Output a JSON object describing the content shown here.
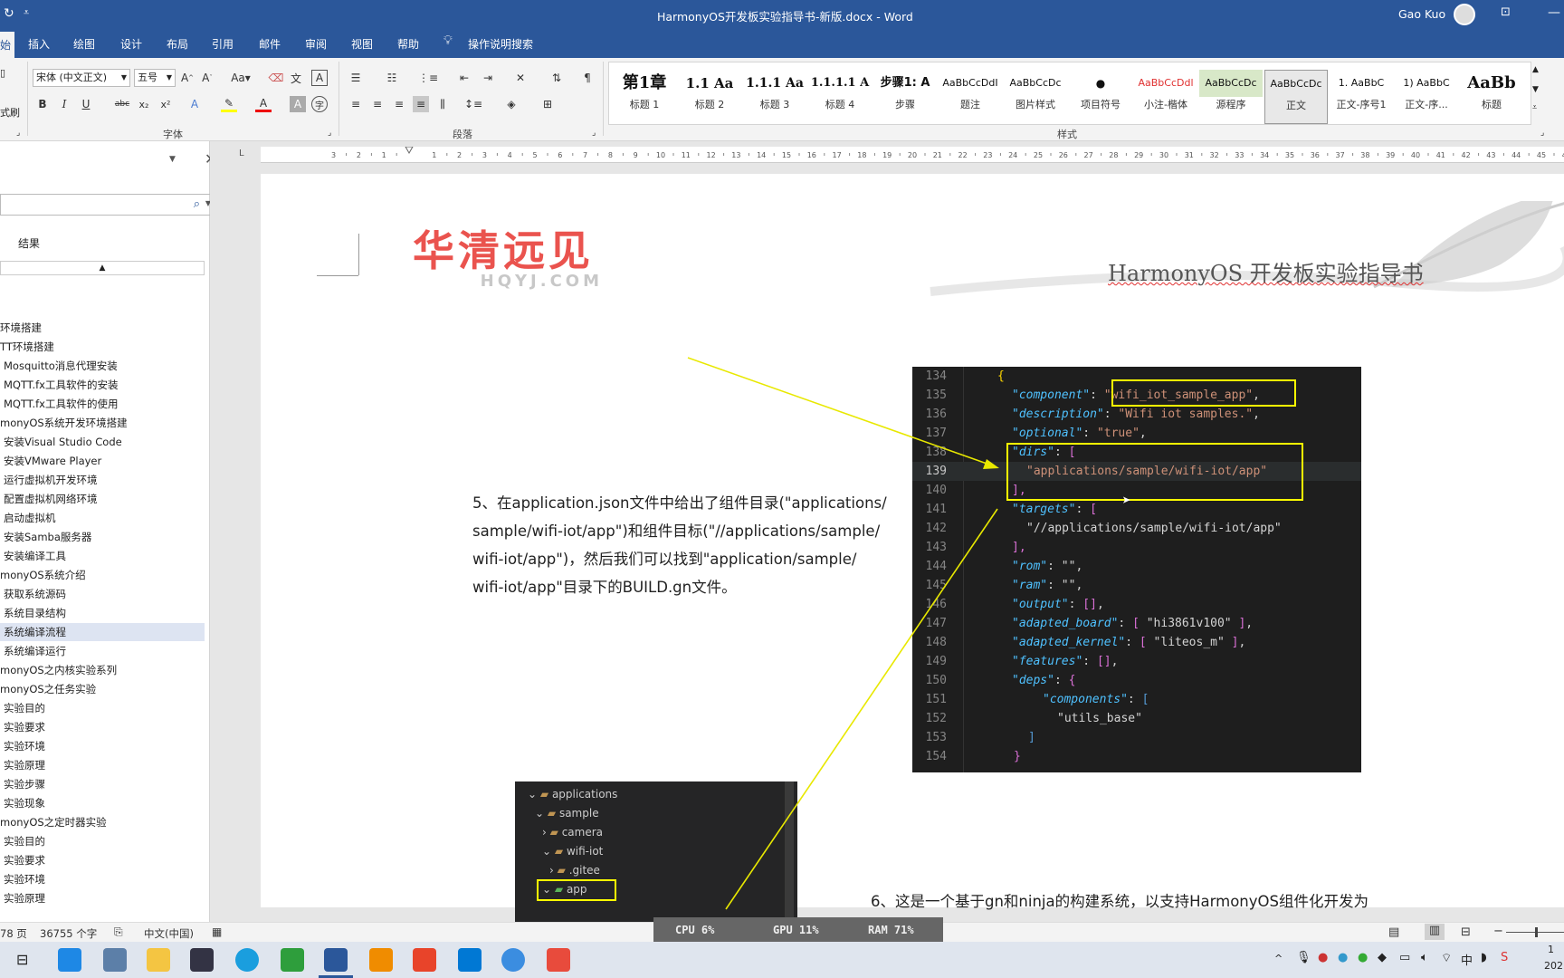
{
  "titlebar": {
    "doc_title": "HarmonyOS开发板实验指导书-新版.docx  -  Word",
    "user": "Gao Kuo"
  },
  "menu": {
    "home_partial": "始",
    "items": [
      "插入",
      "绘图",
      "设计",
      "布局",
      "引用",
      "邮件",
      "审阅",
      "视图",
      "帮助"
    ],
    "search_hint": "操作说明搜索"
  },
  "ribbon": {
    "clipboard_partial": "式刷",
    "font_name": "宋体 (中文正文)",
    "font_size": "五号",
    "font_group": "字体",
    "paragraph_group": "段落",
    "styles_group": "样式",
    "styles": [
      {
        "preview": "第1章",
        "name": "标题 1"
      },
      {
        "preview": "1.1  Aa",
        "name": "标题 2"
      },
      {
        "preview": "1.1.1  Aa",
        "name": "标题 3"
      },
      {
        "preview": "1.1.1.1  A",
        "name": "标题 4"
      },
      {
        "preview": "步骤1: A",
        "name": "步骤"
      },
      {
        "preview": "AaBbCcDdI",
        "name": "题注"
      },
      {
        "preview": "AaBbCcDc",
        "name": "图片样式"
      },
      {
        "preview": "●",
        "name": "项目符号"
      },
      {
        "preview": "AaBbCcDdl",
        "name": "小注-楷体"
      },
      {
        "preview": "AaBbCcDc",
        "name": "源程序"
      },
      {
        "preview": "AaBbCcDc",
        "name": "正文"
      },
      {
        "preview": "1.  AaBbC",
        "name": "正文-序号1"
      },
      {
        "preview": "1)  AaBbC",
        "name": "正文-序..."
      },
      {
        "preview": "AaBb",
        "name": "标题"
      }
    ]
  },
  "navpane": {
    "results_tab": "结果",
    "items": [
      "环境搭建",
      "TT环境搭建",
      "Mosquitto消息代理安装",
      "MQTT.fx工具软件的安装",
      "MQTT.fx工具软件的使用",
      "monyOS系统开发环境搭建",
      "安装Visual Studio Code",
      "安装VMware Player",
      "运行虚拟机开发环境",
      "配置虚拟机网络环境",
      "启动虚拟机",
      "安装Samba服务器",
      "安装编译工具",
      "monyOS系统介绍",
      "获取系统源码",
      "系统目录结构",
      "系统编译流程",
      "系统编译运行",
      "monyOS之内核实验系列",
      "monyOS之任务实验",
      "实验目的",
      "实验要求",
      "实验环境",
      "实验原理",
      "实验步骤",
      "实验现象",
      "monyOS之定时器实验",
      "实验目的",
      "实验要求",
      "实验环境",
      "实验原理"
    ]
  },
  "header": {
    "logo_cn": "华清远见",
    "logo_en": "HQYJ.COM",
    "book_title": "HarmonyOS 开发板实验指导书"
  },
  "body": {
    "para5_lines": [
      "5、在application.json文件中给出了组件目录(\"applications/",
      "sample/wifi-iot/app\")和组件目标(\"//applications/sample/",
      "wifi-iot/app\")，然后我们可以找到\"application/sample/",
      "wifi-iot/app\"目录下的BUILD.gn文件。"
    ],
    "para6": "6、这是一个基于gn和ninja的构建系统，以支持HarmonyOS组件化开发为"
  },
  "code": {
    "line_numbers": [
      "134",
      "135",
      "136",
      "137",
      "138",
      "139",
      "140",
      "141",
      "142",
      "143",
      "144",
      "145",
      "146",
      "147",
      "148",
      "149",
      "150",
      "151",
      "152",
      "153",
      "154"
    ],
    "l134": "{",
    "l135k": "\"component\"",
    "l135v": "\"wifi_iot_sample_app\"",
    "l136k": "\"description\"",
    "l136v": "\"Wifi iot samples.\"",
    "l137k": "\"optional\"",
    "l137v": "\"true\"",
    "l138k": "\"dirs\"",
    "l139v": "\"applications/sample/wifi-iot/app\"",
    "l140": "],",
    "l141k": "\"targets\"",
    "l142v": "\"//applications/sample/wifi-iot/app\"",
    "l143": "],",
    "l144k": "\"rom\"",
    "l144v": "\"\"",
    "l145k": "\"ram\"",
    "l145v": "\"\"",
    "l146k": "\"output\"",
    "l147k": "\"adapted_board\"",
    "l147v": "\"hi3861v100\"",
    "l148k": "\"adapted_kernel\"",
    "l148v": "\"liteos_m\"",
    "l149k": "\"features\"",
    "l150k": "\"deps\"",
    "l151k": "\"components\"",
    "l152v": "\"utils_base\"",
    "l153": "]",
    "l154": "}"
  },
  "tree": {
    "items": [
      "applications",
      "sample",
      "camera",
      "wifi-iot",
      ".gitee",
      "app"
    ]
  },
  "status": {
    "pages": "78 页",
    "words": "36755 个字",
    "language": "中文(中国)",
    "cpu": "CPU   6%",
    "gpu": "GPU  11%",
    "ram": "RAM  71%",
    "clock_time": "1",
    "clock_date": "202"
  }
}
